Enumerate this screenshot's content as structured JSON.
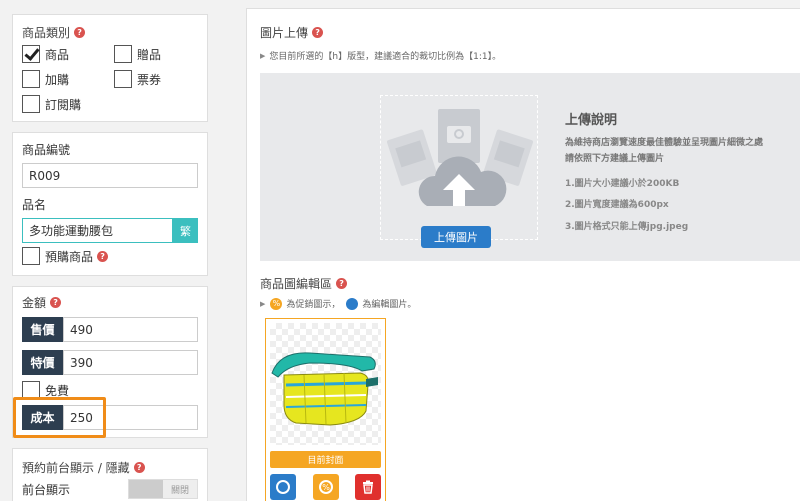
{
  "category": {
    "title": "商品類別",
    "options": [
      {
        "label": "商品",
        "checked": true
      },
      {
        "label": "贈品",
        "checked": false
      },
      {
        "label": "加購",
        "checked": false
      },
      {
        "label": "票券",
        "checked": false
      },
      {
        "label": "訂閱購",
        "checked": false
      }
    ]
  },
  "product": {
    "code_label": "商品編號",
    "code_value": "R009",
    "name_label": "品名",
    "name_value": "多功能運動腰包",
    "name_button": "繁",
    "preorder_label": "預購商品"
  },
  "price": {
    "title": "金額",
    "sale_label": "售價",
    "sale_value": "490",
    "special_label": "特價",
    "special_value": "390",
    "free_label": "免費",
    "cost_label": "成本",
    "cost_value": "250",
    "highlight_color": "#f08c18"
  },
  "schedule": {
    "title": "預約前台顯示 / 隱藏",
    "front_label": "前台顯示",
    "toggle_label": "關閉"
  },
  "upload": {
    "title": "圖片上傳",
    "hint": "您目前所選的【h】版型，建議適合的裁切比例為【1:1】。",
    "button_label": "上傳圖片",
    "instructions_title": "上傳說明",
    "instructions_lines": [
      "為維持商店瀏覽速度最佳體驗並呈現圖片細微之處",
      "請依照下方建議上傳圖片"
    ],
    "rules": [
      "1.圖片大小建議小於200KB",
      "2.圖片寬度建議為600px",
      "3.圖片格式只能上傳jpg.jpeg"
    ]
  },
  "gallery": {
    "title": "商品圖編輯區",
    "hint_promo": "為促銷圖示，",
    "hint_edit": "為編輯圖片。",
    "cover_label": "目前封面",
    "colors": {
      "blue": "#2b7cc9",
      "orange": "#f5a623",
      "red": "#e0302d"
    }
  }
}
